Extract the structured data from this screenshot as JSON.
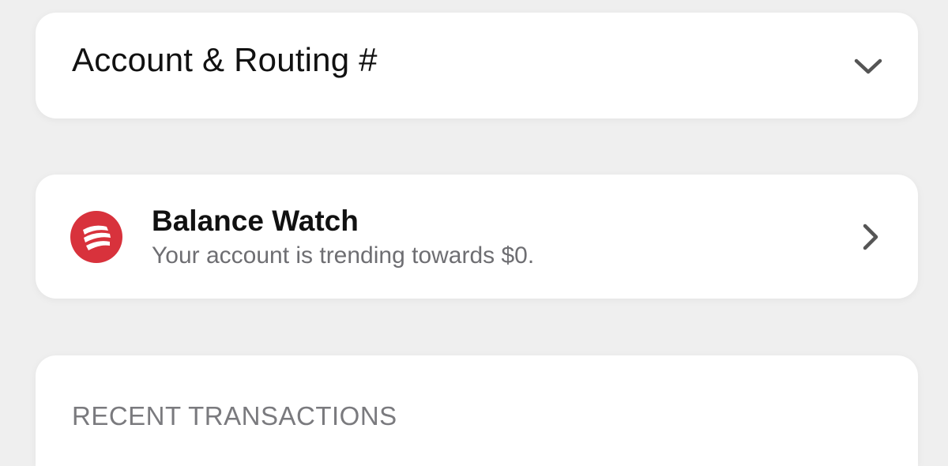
{
  "account_routing": {
    "title": "Account & Routing #",
    "chevron_icon": "chevron-down-icon"
  },
  "balance_watch": {
    "title": "Balance Watch",
    "subtitle": "Your account is trending towards $0.",
    "logo_icon": "bank-logo-icon",
    "logo_color": "#d8323c",
    "chevron_icon": "chevron-right-icon"
  },
  "recent_transactions": {
    "header": "RECENT TRANSACTIONS"
  }
}
